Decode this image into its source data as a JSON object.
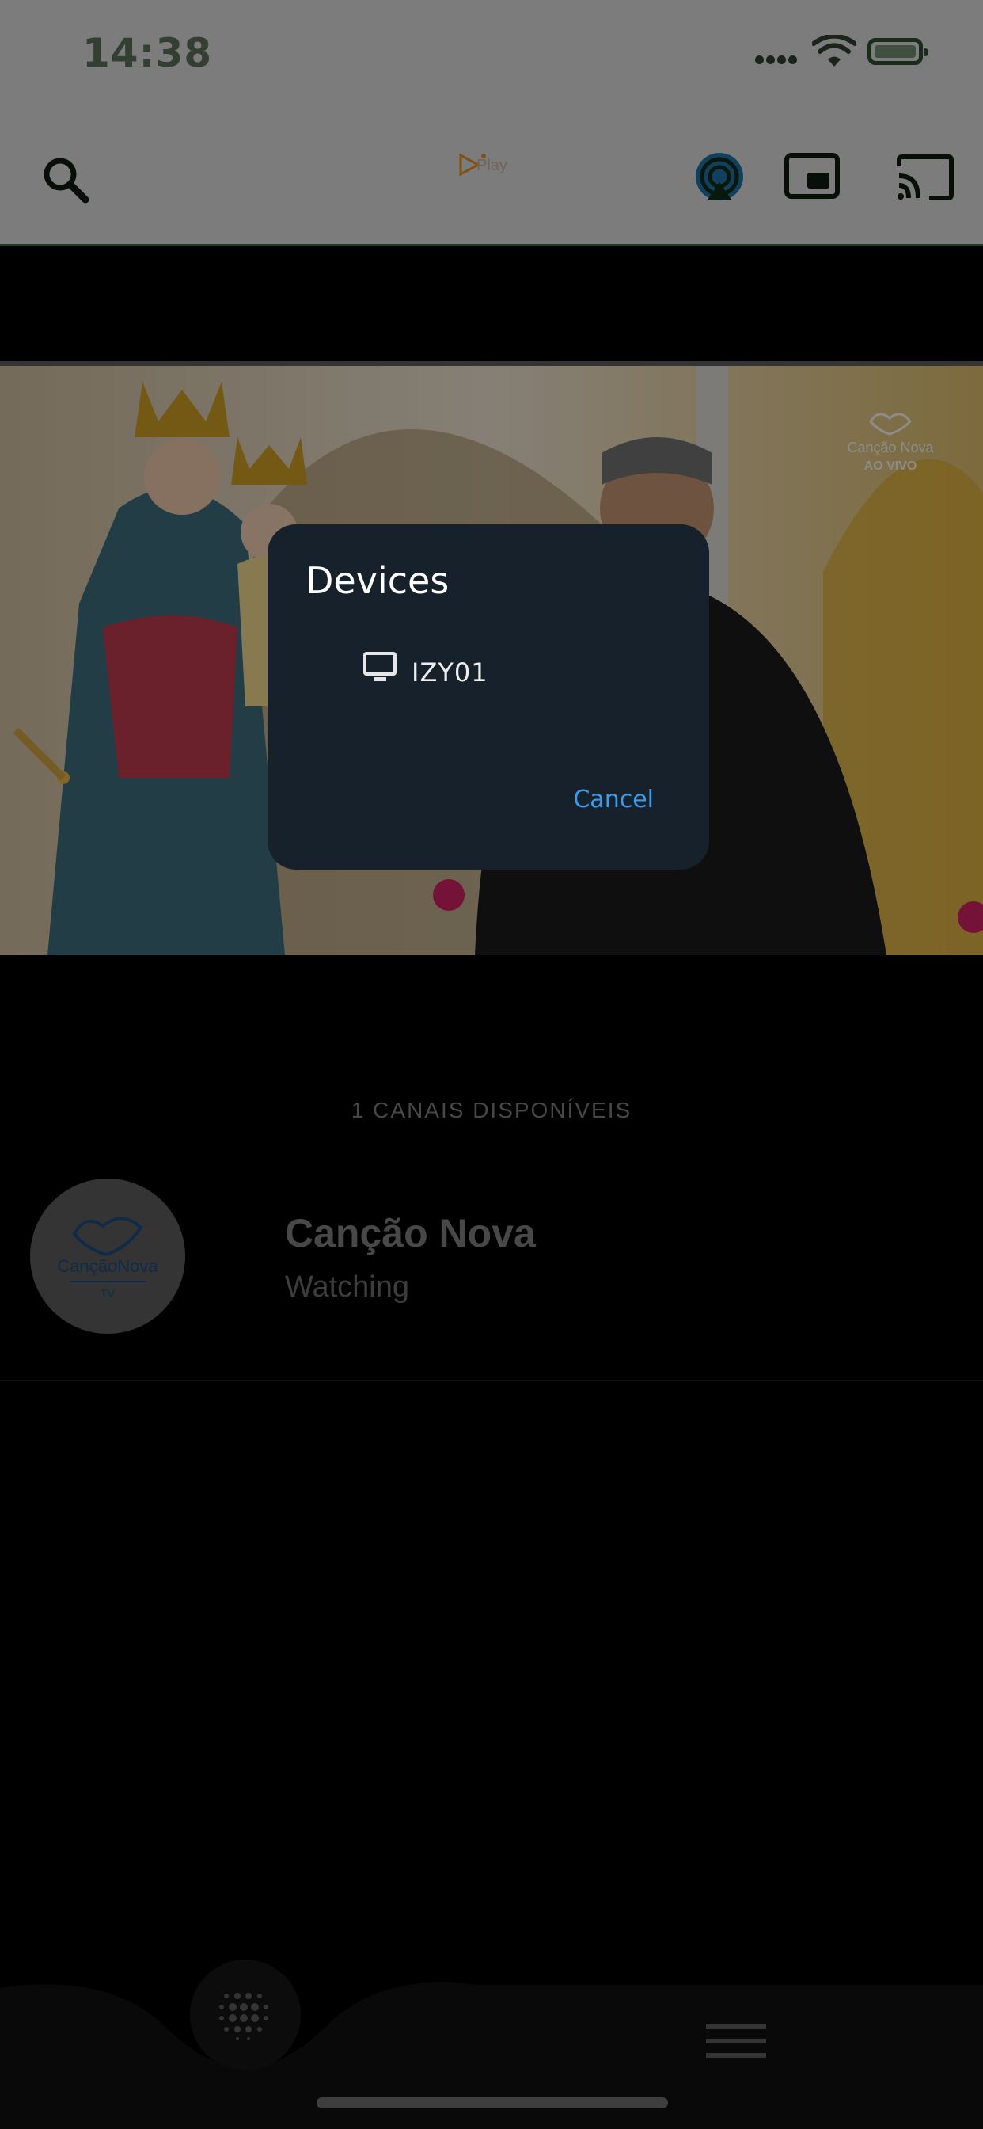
{
  "status_bar": {
    "time": "14:38"
  },
  "toolbar": {
    "logo_text": "Play",
    "accent_color": "#e08a1e"
  },
  "dialog": {
    "title": "Devices",
    "devices": [
      {
        "name": "IZY01",
        "icon": "tv-monitor-icon"
      }
    ],
    "cancel_label": "Cancel",
    "background": "#17212b",
    "accent": "#3d9be9"
  },
  "video": {
    "watermark_brand": "Canção Nova",
    "watermark_live": "AO VIVO"
  },
  "channels": {
    "heading": "1 CANAIS DISPONÍVEIS",
    "items": [
      {
        "title": "Canção Nova",
        "status": "Watching",
        "logo_text": "CançãoNova",
        "logo_sub": "TV"
      }
    ]
  },
  "bottom_nav": {
    "items": [
      {
        "icon": "dot-grid-icon"
      },
      {
        "icon": "menu-icon"
      }
    ]
  }
}
